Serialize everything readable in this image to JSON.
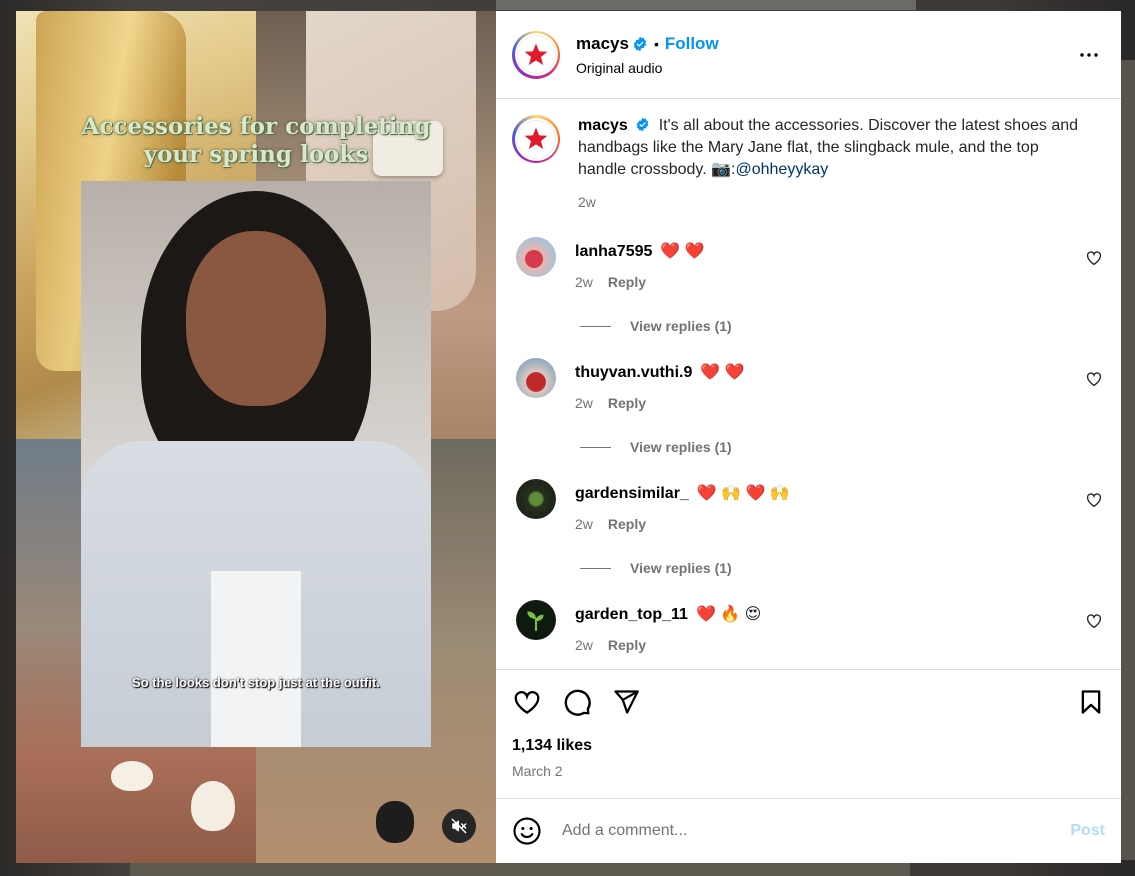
{
  "post": {
    "username": "macys",
    "follow_label": "Follow",
    "audio": "Original audio",
    "more_icon": "more-horizontal-icon"
  },
  "media": {
    "overlay_title_line1": "Accessories for completing",
    "overlay_title_line2": "your spring looks",
    "subtitle": "So the looks don't stop just at the outfit.",
    "mute_icon": "speaker-muted-icon"
  },
  "caption": {
    "username": "macys",
    "text": "It's all about the accessories. Discover the latest shoes and handbags like the Mary Jane flat, the slingback mule, and the top handle crossbody. 📷:",
    "mention": "@ohheyykay",
    "time": "2w"
  },
  "comments": [
    {
      "username": "lanha7595",
      "text": "❤️ ❤️",
      "time": "2w",
      "reply": "Reply",
      "view_replies": "View replies (1)",
      "avatar_color": "#c8878c"
    },
    {
      "username": "thuyvan.vuthi.9",
      "text": "❤️ ❤️",
      "time": "2w",
      "reply": "Reply",
      "view_replies": "View replies (1)",
      "avatar_color": "#b04a4a"
    },
    {
      "username": "gardensimilar_",
      "text": "❤️ 🙌 ❤️ 🙌",
      "time": "2w",
      "reply": "Reply",
      "view_replies": "View replies (1)",
      "avatar_color": "#2f3a25"
    },
    {
      "username": "garden_top_11",
      "text": "❤️ 🔥 😍",
      "time": "2w",
      "reply": "Reply",
      "avatar_color": "#0e1a10"
    }
  ],
  "footer": {
    "likes": "1,134 likes",
    "date": "March 2",
    "comment_placeholder": "Add a comment...",
    "post_label": "Post"
  },
  "colors": {
    "accent": "#0095f6",
    "macys_red": "#e21a2c",
    "post_disabled": "#b3dbff"
  }
}
